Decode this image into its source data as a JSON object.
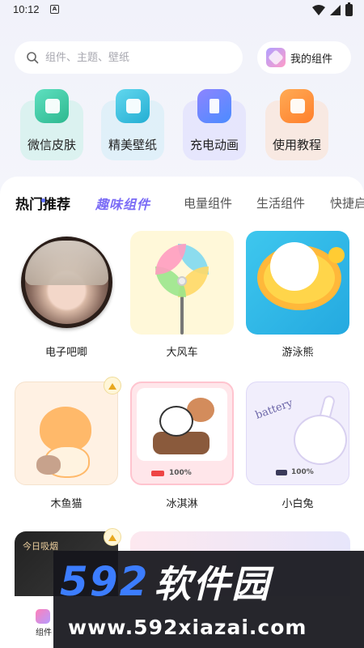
{
  "status": {
    "time": "10:12",
    "notif_icon": "A"
  },
  "search": {
    "placeholder": "组件、主题、壁纸"
  },
  "my_widgets": {
    "label": "我的组件"
  },
  "quick_actions": [
    {
      "label": "微信皮肤",
      "icon": "tshirt-icon",
      "color": "#3cc8a0"
    },
    {
      "label": "精美壁纸",
      "icon": "image-icon",
      "color": "#2fb6dc"
    },
    {
      "label": "充电动画",
      "icon": "battery-charge-icon",
      "color": "#6a86ff"
    },
    {
      "label": "使用教程",
      "icon": "document-icon",
      "color": "#ff8f3a"
    }
  ],
  "tabs": [
    {
      "label": "热门推荐",
      "active": true
    },
    {
      "label": "趣味组件"
    },
    {
      "label": "电量组件"
    },
    {
      "label": "生活组件"
    },
    {
      "label": "快捷启"
    }
  ],
  "widgets": [
    {
      "caption": "电子吧唧"
    },
    {
      "caption": "大风车"
    },
    {
      "caption": "游泳熊"
    },
    {
      "caption": "木鱼猫",
      "premium": true
    },
    {
      "caption": "冰淇淋",
      "battery_text": "100%"
    },
    {
      "caption": "小白兔",
      "battery_text": "100%",
      "art_text": "battery"
    },
    {
      "card_text": "今日吸烟",
      "premium": true
    },
    {}
  ],
  "bottom_nav": {
    "item_label": "组件"
  },
  "watermark": {
    "logo_num": "592",
    "logo_cn": "软件园",
    "url": "www.592xiazai.com"
  },
  "colors": {
    "accent": "#7b6cf6",
    "indicator": "#5a6bff",
    "watermark_blue": "#3c7dff"
  }
}
